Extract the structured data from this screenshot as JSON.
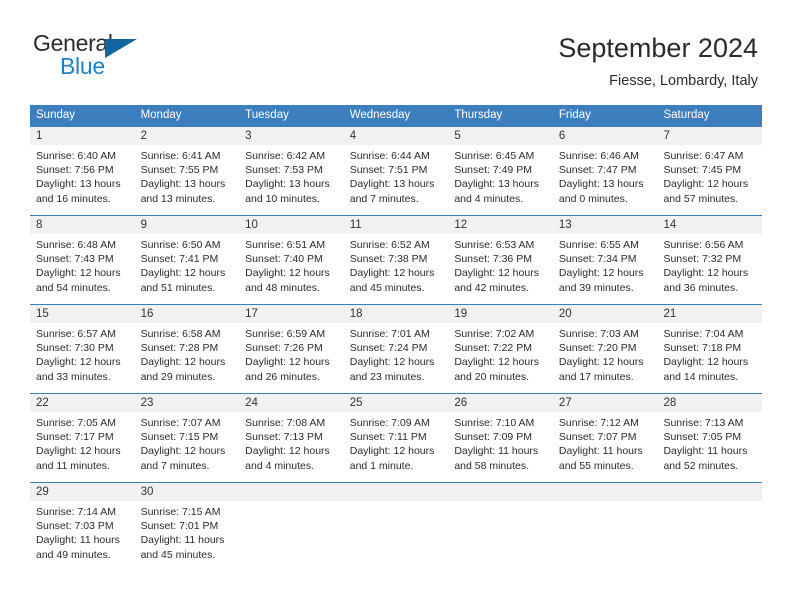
{
  "brand": {
    "name_part1": "General",
    "name_part2": "Blue",
    "flag_icon": "triangle-flag-icon",
    "accent_color": "#13659f",
    "blue_text_color": "#1f7fc4"
  },
  "header": {
    "title": "September 2024",
    "subtitle": "Fiesse, Lombardy, Italy"
  },
  "calendar": {
    "header_bg_color": "#3d7ebf",
    "day_band_color": "#f1f1f1",
    "weekdays": [
      "Sunday",
      "Monday",
      "Tuesday",
      "Wednesday",
      "Thursday",
      "Friday",
      "Saturday"
    ],
    "weeks": [
      [
        {
          "day": "1",
          "sunrise": "Sunrise: 6:40 AM",
          "sunset": "Sunset: 7:56 PM",
          "daylight_line1": "Daylight: 13 hours",
          "daylight_line2": "and 16 minutes."
        },
        {
          "day": "2",
          "sunrise": "Sunrise: 6:41 AM",
          "sunset": "Sunset: 7:55 PM",
          "daylight_line1": "Daylight: 13 hours",
          "daylight_line2": "and 13 minutes."
        },
        {
          "day": "3",
          "sunrise": "Sunrise: 6:42 AM",
          "sunset": "Sunset: 7:53 PM",
          "daylight_line1": "Daylight: 13 hours",
          "daylight_line2": "and 10 minutes."
        },
        {
          "day": "4",
          "sunrise": "Sunrise: 6:44 AM",
          "sunset": "Sunset: 7:51 PM",
          "daylight_line1": "Daylight: 13 hours",
          "daylight_line2": "and 7 minutes."
        },
        {
          "day": "5",
          "sunrise": "Sunrise: 6:45 AM",
          "sunset": "Sunset: 7:49 PM",
          "daylight_line1": "Daylight: 13 hours",
          "daylight_line2": "and 4 minutes."
        },
        {
          "day": "6",
          "sunrise": "Sunrise: 6:46 AM",
          "sunset": "Sunset: 7:47 PM",
          "daylight_line1": "Daylight: 13 hours",
          "daylight_line2": "and 0 minutes."
        },
        {
          "day": "7",
          "sunrise": "Sunrise: 6:47 AM",
          "sunset": "Sunset: 7:45 PM",
          "daylight_line1": "Daylight: 12 hours",
          "daylight_line2": "and 57 minutes."
        }
      ],
      [
        {
          "day": "8",
          "sunrise": "Sunrise: 6:48 AM",
          "sunset": "Sunset: 7:43 PM",
          "daylight_line1": "Daylight: 12 hours",
          "daylight_line2": "and 54 minutes."
        },
        {
          "day": "9",
          "sunrise": "Sunrise: 6:50 AM",
          "sunset": "Sunset: 7:41 PM",
          "daylight_line1": "Daylight: 12 hours",
          "daylight_line2": "and 51 minutes."
        },
        {
          "day": "10",
          "sunrise": "Sunrise: 6:51 AM",
          "sunset": "Sunset: 7:40 PM",
          "daylight_line1": "Daylight: 12 hours",
          "daylight_line2": "and 48 minutes."
        },
        {
          "day": "11",
          "sunrise": "Sunrise: 6:52 AM",
          "sunset": "Sunset: 7:38 PM",
          "daylight_line1": "Daylight: 12 hours",
          "daylight_line2": "and 45 minutes."
        },
        {
          "day": "12",
          "sunrise": "Sunrise: 6:53 AM",
          "sunset": "Sunset: 7:36 PM",
          "daylight_line1": "Daylight: 12 hours",
          "daylight_line2": "and 42 minutes."
        },
        {
          "day": "13",
          "sunrise": "Sunrise: 6:55 AM",
          "sunset": "Sunset: 7:34 PM",
          "daylight_line1": "Daylight: 12 hours",
          "daylight_line2": "and 39 minutes."
        },
        {
          "day": "14",
          "sunrise": "Sunrise: 6:56 AM",
          "sunset": "Sunset: 7:32 PM",
          "daylight_line1": "Daylight: 12 hours",
          "daylight_line2": "and 36 minutes."
        }
      ],
      [
        {
          "day": "15",
          "sunrise": "Sunrise: 6:57 AM",
          "sunset": "Sunset: 7:30 PM",
          "daylight_line1": "Daylight: 12 hours",
          "daylight_line2": "and 33 minutes."
        },
        {
          "day": "16",
          "sunrise": "Sunrise: 6:58 AM",
          "sunset": "Sunset: 7:28 PM",
          "daylight_line1": "Daylight: 12 hours",
          "daylight_line2": "and 29 minutes."
        },
        {
          "day": "17",
          "sunrise": "Sunrise: 6:59 AM",
          "sunset": "Sunset: 7:26 PM",
          "daylight_line1": "Daylight: 12 hours",
          "daylight_line2": "and 26 minutes."
        },
        {
          "day": "18",
          "sunrise": "Sunrise: 7:01 AM",
          "sunset": "Sunset: 7:24 PM",
          "daylight_line1": "Daylight: 12 hours",
          "daylight_line2": "and 23 minutes."
        },
        {
          "day": "19",
          "sunrise": "Sunrise: 7:02 AM",
          "sunset": "Sunset: 7:22 PM",
          "daylight_line1": "Daylight: 12 hours",
          "daylight_line2": "and 20 minutes."
        },
        {
          "day": "20",
          "sunrise": "Sunrise: 7:03 AM",
          "sunset": "Sunset: 7:20 PM",
          "daylight_line1": "Daylight: 12 hours",
          "daylight_line2": "and 17 minutes."
        },
        {
          "day": "21",
          "sunrise": "Sunrise: 7:04 AM",
          "sunset": "Sunset: 7:18 PM",
          "daylight_line1": "Daylight: 12 hours",
          "daylight_line2": "and 14 minutes."
        }
      ],
      [
        {
          "day": "22",
          "sunrise": "Sunrise: 7:05 AM",
          "sunset": "Sunset: 7:17 PM",
          "daylight_line1": "Daylight: 12 hours",
          "daylight_line2": "and 11 minutes."
        },
        {
          "day": "23",
          "sunrise": "Sunrise: 7:07 AM",
          "sunset": "Sunset: 7:15 PM",
          "daylight_line1": "Daylight: 12 hours",
          "daylight_line2": "and 7 minutes."
        },
        {
          "day": "24",
          "sunrise": "Sunrise: 7:08 AM",
          "sunset": "Sunset: 7:13 PM",
          "daylight_line1": "Daylight: 12 hours",
          "daylight_line2": "and 4 minutes."
        },
        {
          "day": "25",
          "sunrise": "Sunrise: 7:09 AM",
          "sunset": "Sunset: 7:11 PM",
          "daylight_line1": "Daylight: 12 hours",
          "daylight_line2": "and 1 minute."
        },
        {
          "day": "26",
          "sunrise": "Sunrise: 7:10 AM",
          "sunset": "Sunset: 7:09 PM",
          "daylight_line1": "Daylight: 11 hours",
          "daylight_line2": "and 58 minutes."
        },
        {
          "day": "27",
          "sunrise": "Sunrise: 7:12 AM",
          "sunset": "Sunset: 7:07 PM",
          "daylight_line1": "Daylight: 11 hours",
          "daylight_line2": "and 55 minutes."
        },
        {
          "day": "28",
          "sunrise": "Sunrise: 7:13 AM",
          "sunset": "Sunset: 7:05 PM",
          "daylight_line1": "Daylight: 11 hours",
          "daylight_line2": "and 52 minutes."
        }
      ],
      [
        {
          "day": "29",
          "sunrise": "Sunrise: 7:14 AM",
          "sunset": "Sunset: 7:03 PM",
          "daylight_line1": "Daylight: 11 hours",
          "daylight_line2": "and 49 minutes."
        },
        {
          "day": "30",
          "sunrise": "Sunrise: 7:15 AM",
          "sunset": "Sunset: 7:01 PM",
          "daylight_line1": "Daylight: 11 hours",
          "daylight_line2": "and 45 minutes."
        },
        {
          "day": "",
          "sunrise": "",
          "sunset": "",
          "daylight_line1": "",
          "daylight_line2": ""
        },
        {
          "day": "",
          "sunrise": "",
          "sunset": "",
          "daylight_line1": "",
          "daylight_line2": ""
        },
        {
          "day": "",
          "sunrise": "",
          "sunset": "",
          "daylight_line1": "",
          "daylight_line2": ""
        },
        {
          "day": "",
          "sunrise": "",
          "sunset": "",
          "daylight_line1": "",
          "daylight_line2": ""
        },
        {
          "day": "",
          "sunrise": "",
          "sunset": "",
          "daylight_line1": "",
          "daylight_line2": ""
        }
      ]
    ]
  }
}
